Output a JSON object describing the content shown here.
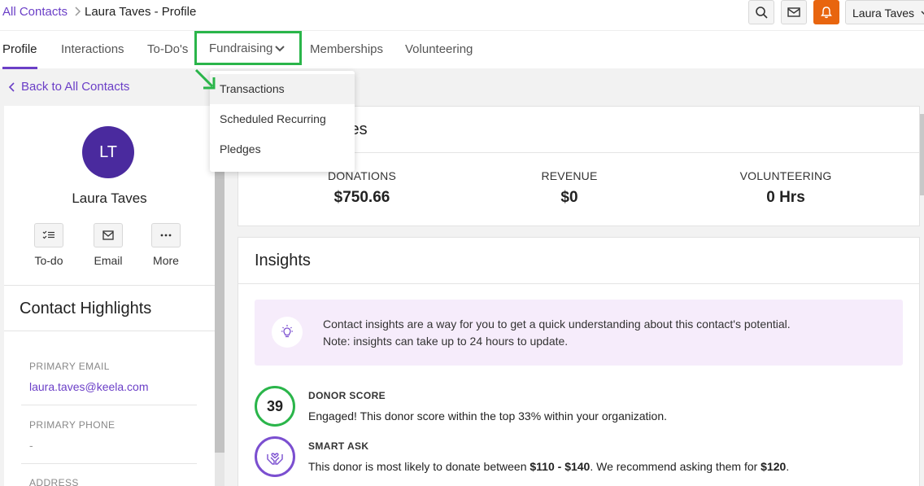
{
  "breadcrumb": {
    "root": "All Contacts",
    "current": "Laura Taves - Profile"
  },
  "topbar": {
    "user_label": "Laura Taves",
    "icons": [
      "search-icon",
      "mail-icon",
      "bell-icon",
      "chevron-down-icon"
    ],
    "bell_color": "#e8650f"
  },
  "tabs": [
    "Profile",
    "Interactions",
    "To-Do's",
    "Fundraising",
    "Memberships",
    "Volunteering"
  ],
  "fundraising_menu": [
    "Transactions",
    "Scheduled Recurring",
    "Pledges"
  ],
  "back_link": "Back to All Contacts",
  "contact": {
    "initials": "LT",
    "name": "Laura Taves",
    "actions": [
      "To-do",
      "Email",
      "More"
    ]
  },
  "highlights": {
    "title": "Contact Highlights",
    "email_label": "PRIMARY EMAIL",
    "email": "laura.taves@keela.com",
    "phone_label": "PRIMARY PHONE",
    "phone": "-",
    "address_label": "ADDRESS"
  },
  "stats": {
    "title_fragment": "tes",
    "items": [
      {
        "label": "DONATIONS",
        "value": "$750.66"
      },
      {
        "label": "REVENUE",
        "value": "$0"
      },
      {
        "label": "VOLUNTEERING",
        "value": "0 Hrs"
      }
    ]
  },
  "insights": {
    "title": "Insights",
    "note_line1": "Contact insights are a way for you to get a quick understanding about this contact's potential.",
    "note_line2": "Note: insights can take up to 24 hours to update.",
    "donor_score": {
      "value": "39",
      "heading": "DONOR SCORE",
      "text": "Engaged! This donor score within the top 33% within your organization."
    },
    "smart_ask": {
      "heading": "SMART ASK",
      "text_before": "This donor is most likely to donate between ",
      "range": "$110 - $140",
      "text_middle": ". We recommend asking them for ",
      "amount": "$120",
      "text_after": "."
    }
  },
  "colors": {
    "accent": "#6b3fc7",
    "highlight": "#2ab54a",
    "avatar": "#4a2a9e",
    "note_bg": "#f6ecfb"
  }
}
